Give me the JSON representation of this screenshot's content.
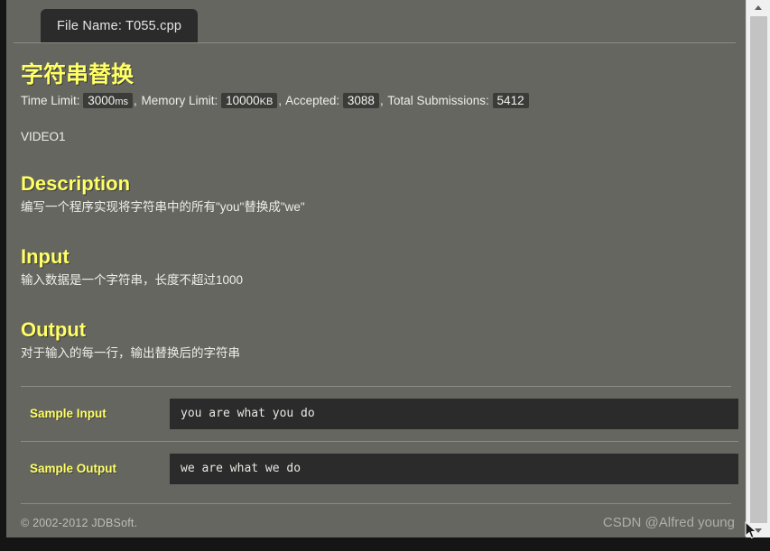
{
  "colors": {
    "page_background": "#656660",
    "panel_dark": "#2b2b2b",
    "accent_yellow": "#ffff66",
    "body_text": "#efeee9",
    "rule": "#8b8c85",
    "window_chrome": "#151515",
    "scrollbar_track": "#f0f0f0",
    "scrollbar_thumb": "#c3c3c3"
  },
  "tab": {
    "label": "File Name: T055.cpp"
  },
  "problem": {
    "title": "字符串替换",
    "meta": {
      "time_limit_label": "Time Limit:",
      "time_limit_value": "3000",
      "time_limit_unit": "ms",
      "memory_limit_label": "Memory Limit:",
      "memory_limit_value": "10000",
      "memory_limit_unit": "KB",
      "accepted_label": "Accepted:",
      "accepted_value": "3088",
      "total_submissions_label": "Total Submissions:",
      "total_submissions_value": "5412",
      "separator": ","
    },
    "video_link": "VIDEO1"
  },
  "sections": [
    {
      "heading": "Description",
      "body": "编写一个程序实现将字符串中的所有\"you\"替换成\"we\""
    },
    {
      "heading": "Input",
      "body": "输入数据是一个字符串，长度不超过1000"
    },
    {
      "heading": "Output",
      "body": "对于输入的每一行，输出替换后的字符串"
    }
  ],
  "samples": [
    {
      "label": "Sample Input",
      "text": "you are what you do"
    },
    {
      "label": "Sample Output",
      "text": "we are what we do"
    }
  ],
  "footer": {
    "copyright": "© 2002-2012 JDBSoft."
  },
  "watermark": {
    "text": "CSDN @Alfred young"
  },
  "scrollbar": {
    "up_arrow_icon": "scroll-up-arrow-icon",
    "down_arrow_icon": "scroll-down-arrow-icon"
  }
}
